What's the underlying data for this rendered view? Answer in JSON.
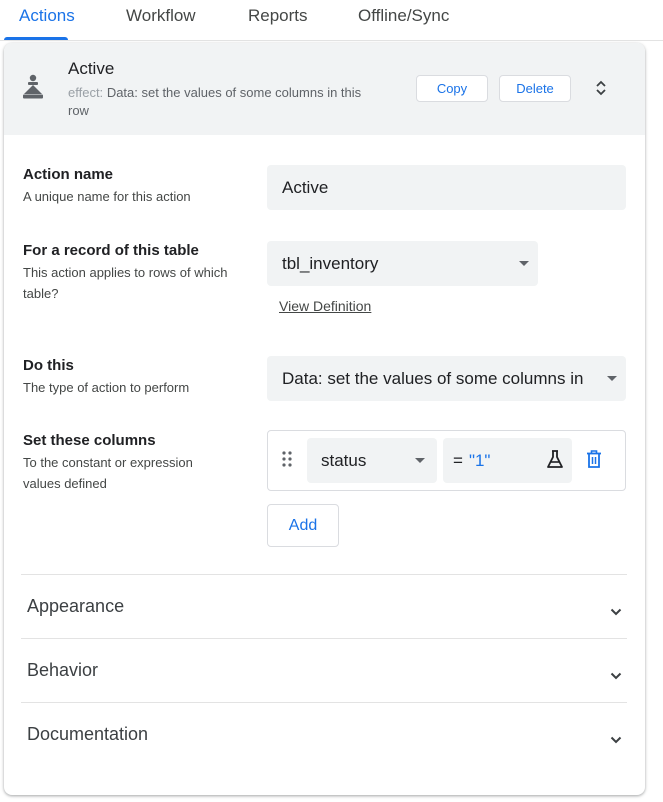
{
  "tabs": [
    {
      "label": "Actions",
      "active": true
    },
    {
      "label": "Workflow",
      "active": false
    },
    {
      "label": "Reports",
      "active": false
    },
    {
      "label": "Offline/Sync",
      "active": false
    }
  ],
  "header": {
    "icon": "action-person-icon",
    "title": "Active",
    "effect_label": "effect:",
    "effect_text": "Data: set the values of some columns in this row",
    "copy_label": "Copy",
    "delete_label": "Delete",
    "expand_icon": "unfold-icon"
  },
  "action_name": {
    "title": "Action name",
    "description": "A unique name for this action",
    "value": "Active"
  },
  "table": {
    "title": "For a record of this table",
    "description": "This action applies to rows of which table?",
    "value": "tbl_inventory",
    "view_definition_label": "View Definition"
  },
  "do_this": {
    "title": "Do this",
    "description": "The type of action to perform",
    "value": "Data: set the values of some columns in this row"
  },
  "set_columns": {
    "title": "Set these columns",
    "description": "To the constant or expression values defined",
    "rows": [
      {
        "column": "status",
        "operator": "=",
        "expression": "\"1\""
      }
    ],
    "add_label": "Add"
  },
  "sections": [
    {
      "label": "Appearance"
    },
    {
      "label": "Behavior"
    },
    {
      "label": "Documentation"
    }
  ],
  "colors": {
    "accent": "#1a73e8",
    "header_bg": "#f1f3f4",
    "field_bg": "#f1f3f4",
    "text": "#202124",
    "muted": "#5f6368"
  }
}
